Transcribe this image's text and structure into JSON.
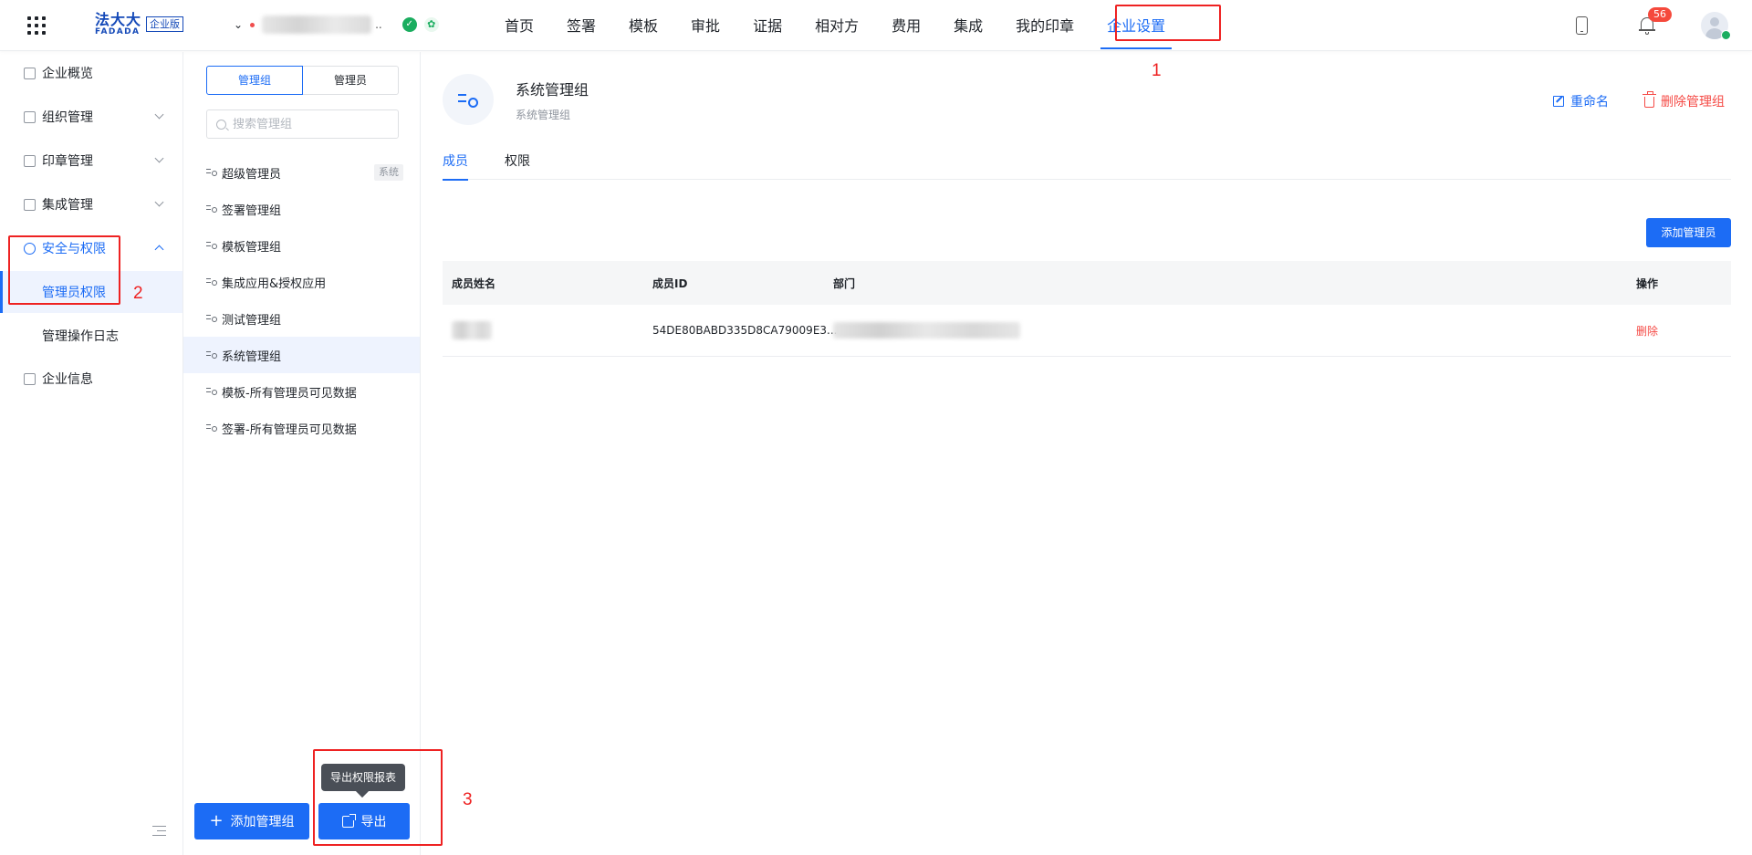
{
  "topbar": {
    "logo": {
      "text": "法大大",
      "sub": "FADADA",
      "badge": "企业版"
    },
    "company_name_suffix": "..",
    "nav": [
      "首页",
      "签署",
      "模板",
      "审批",
      "证据",
      "相对方",
      "费用",
      "集成",
      "我的印章",
      "企业设置"
    ],
    "active_nav": "企业设置",
    "notification_count": "56"
  },
  "annotations": {
    "n1": "1",
    "n2": "2",
    "n3": "3"
  },
  "sidebar": {
    "items": [
      {
        "label": "企业概览",
        "icon": "overview-icon"
      },
      {
        "label": "组织管理",
        "icon": "organization-icon",
        "expandable": true
      },
      {
        "label": "印章管理",
        "icon": "seal-icon",
        "expandable": true
      },
      {
        "label": "集成管理",
        "icon": "integration-icon",
        "expandable": true
      },
      {
        "label": "安全与权限",
        "icon": "security-icon",
        "expandable": true,
        "expanded": true
      },
      {
        "label": "管理员权限",
        "sub": true,
        "active": true
      },
      {
        "label": "管理操作日志",
        "sub": true
      },
      {
        "label": "企业信息",
        "icon": "company-info-icon"
      }
    ]
  },
  "midpanel": {
    "segments": [
      "管理组",
      "管理员"
    ],
    "active_segment": "管理组",
    "search_placeholder": "搜索管理组",
    "groups": [
      {
        "label": "超级管理员",
        "tag": "系统"
      },
      {
        "label": "签署管理组"
      },
      {
        "label": "模板管理组"
      },
      {
        "label": "集成应用&授权应用"
      },
      {
        "label": "测试管理组"
      },
      {
        "label": "系统管理组",
        "active": true
      },
      {
        "label": "模板-所有管理员可见数据"
      },
      {
        "label": "签署-所有管理员可见数据"
      }
    ],
    "add_group_button": "添加管理组",
    "export_button": "导出",
    "export_tooltip": "导出权限报表"
  },
  "main": {
    "group_title": "系统管理组",
    "group_subtitle": "系统管理组",
    "rename": "重命名",
    "delete_group": "删除管理组",
    "tabs": [
      "成员",
      "权限"
    ],
    "active_tab": "成员",
    "add_admin_button": "添加管理员",
    "table": {
      "columns": [
        "成员姓名",
        "成员ID",
        "部门",
        "操作"
      ],
      "rows": [
        {
          "name": "",
          "id": "54DE80BABD335D8CA79009E3...",
          "department": "",
          "action": "删除"
        }
      ]
    }
  },
  "colors": {
    "primary": "#1c6cf5",
    "danger": "#f54a45",
    "annotation": "#ee2222"
  }
}
